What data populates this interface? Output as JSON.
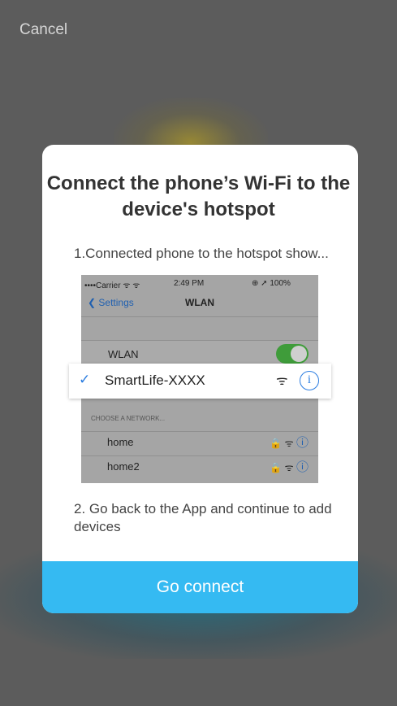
{
  "header": {
    "cancel_label": "Cancel"
  },
  "modal": {
    "title_line1": "Connect the phone’s Wi-Fi to the",
    "title_line2": "device's hotspot",
    "step1": "1.Connected phone to the hotspot show...",
    "step2": "2. Go back to the App and continue to add devices",
    "button_label": "Go connect"
  },
  "illustration": {
    "status": {
      "carrier": "••••Carrier ᯤ ᯤ",
      "time": "2:49 PM",
      "battery": "⊕ ➚ 100%"
    },
    "nav": {
      "back_label": "Settings",
      "title": "WLAN"
    },
    "wlan_label": "WLAN",
    "wlan_enabled": true,
    "hotspot": {
      "name": "SmartLife-XXXX",
      "wifi_glyph": "ᯤ",
      "info_glyph": "i",
      "check_glyph": "✓"
    },
    "section_header": "CHOOSE A NETWORK...",
    "networks": [
      {
        "name": "home",
        "icons": "🔒 ᯤ",
        "info": "ⓘ"
      },
      {
        "name": "home2",
        "icons": "🔒 ᯤ",
        "info": "ⓘ"
      }
    ]
  },
  "colors": {
    "accent": "#35baf2",
    "link_blue": "#2a7ce0",
    "toggle_green": "#3f9c3a",
    "backdrop": "#5c5c5c"
  }
}
